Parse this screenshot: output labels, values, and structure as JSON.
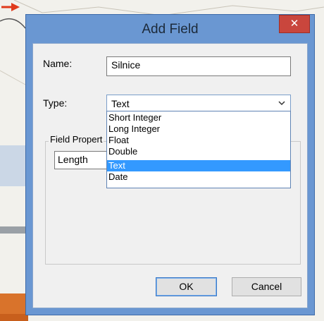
{
  "dialog": {
    "title": "Add Field",
    "close_glyph": "✕",
    "name_label": "Name:",
    "name_value": "Silnice",
    "type_label": "Type:",
    "type_value": "Text",
    "field_properties_label": "Field Propert",
    "property_value": "Length",
    "type_options": [
      "Short Integer",
      "Long Integer",
      "Float",
      "Double",
      "Text",
      "Date"
    ],
    "selected_option_index": 4,
    "ok_label": "OK",
    "cancel_label": "Cancel"
  },
  "icons": {
    "close": "close-icon",
    "chevron": "chevron-down-icon",
    "arrow": "arrow-right-icon"
  },
  "colors": {
    "frame": "#6a97d2",
    "close": "#c9463d",
    "selection": "#3399ff",
    "arrow": "#e03a1c"
  }
}
